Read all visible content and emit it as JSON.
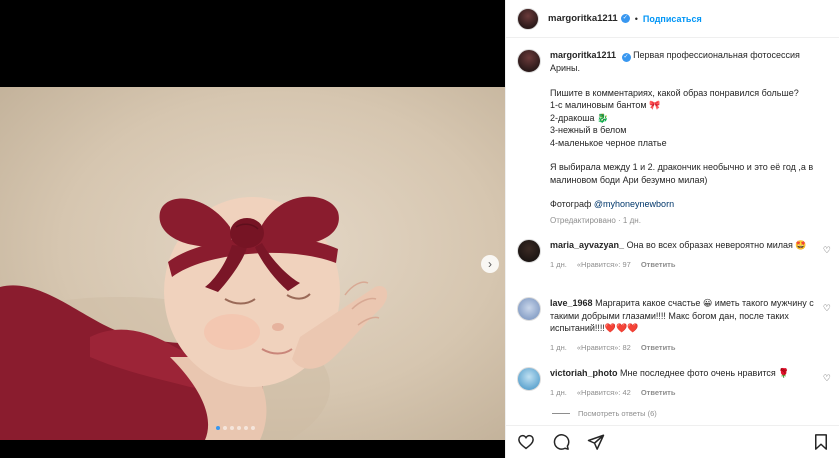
{
  "author": {
    "username": "margoritka1211",
    "separator": "•",
    "follow_label": "Подписаться"
  },
  "caption": {
    "lines": [
      "Первая профессиональная фотосессия Арины."
    ],
    "question": "Пишите в комментариях, какой образ понравился больше?",
    "options": [
      "1-с малиновым бантом 🎀",
      "2-дракоша 🐉",
      "3-нежный в белом",
      "4-маленькое черное платье"
    ],
    "choice": "Я выбирала между 1 и 2. дракончик необычно и это её год ,а в малиновом боди Ари безумно милая)",
    "photographer_prefix": "Фотограф",
    "photographer_link": "@myhoneynewborn",
    "edited": "Отредактировано · 1 дн."
  },
  "comments": [
    {
      "username": "maria_ayvazyan_",
      "text": "Она во всех образах невероятно милая 🤩",
      "time": "1 дн.",
      "likes": "«Нравится»: 97",
      "reply": "Ответить"
    },
    {
      "username": "lave_1968",
      "text": "Маргарита какое счастье 😀 иметь такого мужчину с такими добрыми глазами!!!! Макс богом дан, после таких испытаний!!!!❤️❤️❤️",
      "time": "1 дн.",
      "likes": "«Нравится»: 82",
      "reply": "Ответить"
    },
    {
      "username": "victoriah_photo",
      "text": "Мне последнее фото очень нравится 🌹",
      "time": "1 дн.",
      "likes": "«Нравится»: 42",
      "reply": "Ответить"
    }
  ],
  "view_replies": "Посмотреть ответы (6)",
  "carousel": {
    "total": 6,
    "active": 0
  },
  "colors": {
    "accent": "#0095f6",
    "bow": "#8a1c2e",
    "link": "#00376b"
  }
}
